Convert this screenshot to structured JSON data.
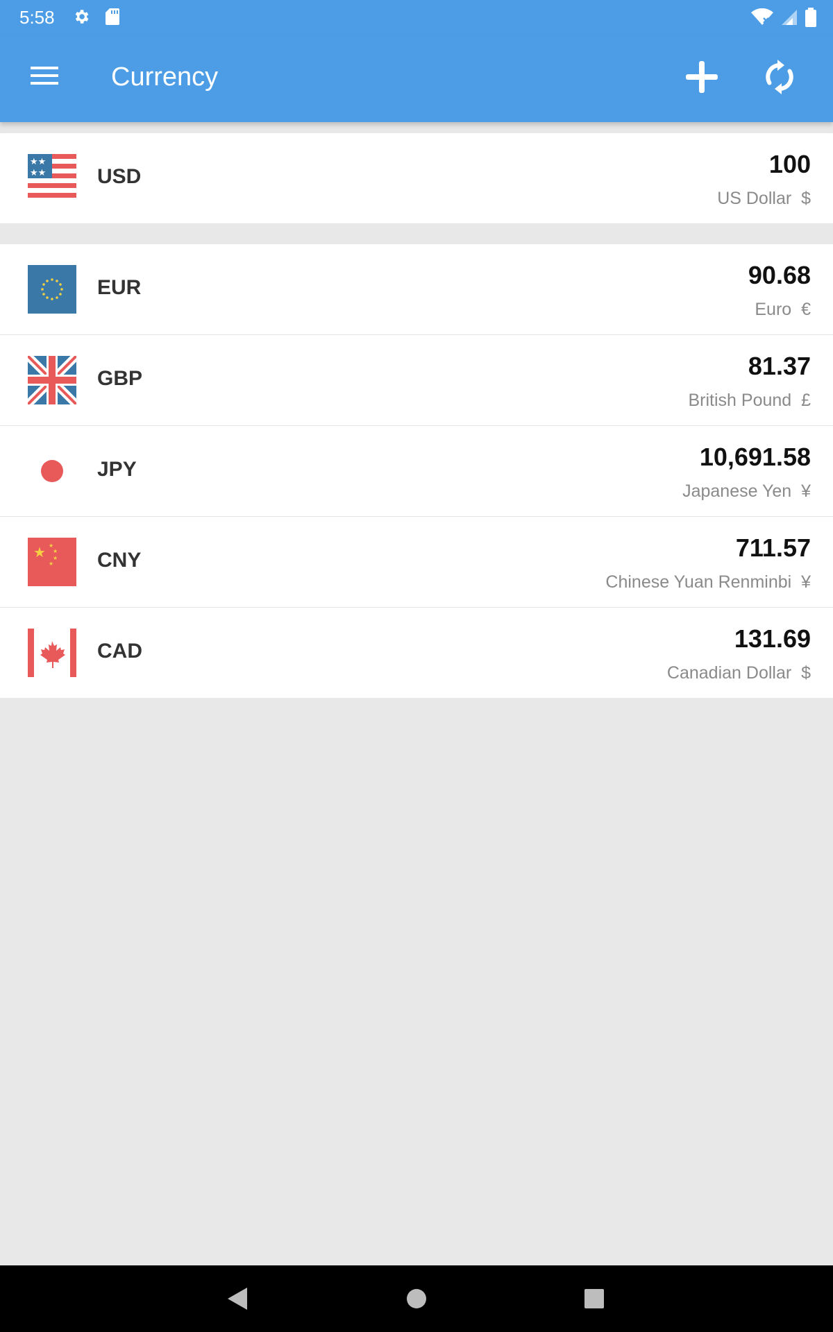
{
  "status_bar": {
    "time": "5:58",
    "left_icons": [
      "gear-icon",
      "sd-card-icon"
    ],
    "right_icons": [
      "wifi-off-icon",
      "signal-icon",
      "battery-icon"
    ]
  },
  "app_bar": {
    "title": "Currency",
    "actions": [
      "add-icon",
      "sync-icon"
    ],
    "color": "#4c9de6"
  },
  "base_currency": {
    "code": "USD",
    "amount": "100",
    "name": "US Dollar",
    "symbol": "$",
    "flag": "us-flag-icon"
  },
  "currencies": [
    {
      "code": "EUR",
      "amount": "90.68",
      "name": "Euro",
      "symbol": "€",
      "flag": "eu-flag-icon"
    },
    {
      "code": "GBP",
      "amount": "81.37",
      "name": "British Pound",
      "symbol": "£",
      "flag": "uk-flag-icon"
    },
    {
      "code": "JPY",
      "amount": "10,691.58",
      "name": "Japanese Yen",
      "symbol": "¥",
      "flag": "jp-flag-icon"
    },
    {
      "code": "CNY",
      "amount": "711.57",
      "name": "Chinese Yuan Renminbi",
      "symbol": "¥",
      "flag": "cn-flag-icon"
    },
    {
      "code": "CAD",
      "amount": "131.69",
      "name": "Canadian Dollar",
      "symbol": "$",
      "flag": "ca-flag-icon"
    }
  ],
  "nav_bar": {
    "buttons": [
      "back-icon",
      "home-icon",
      "recents-icon"
    ]
  }
}
